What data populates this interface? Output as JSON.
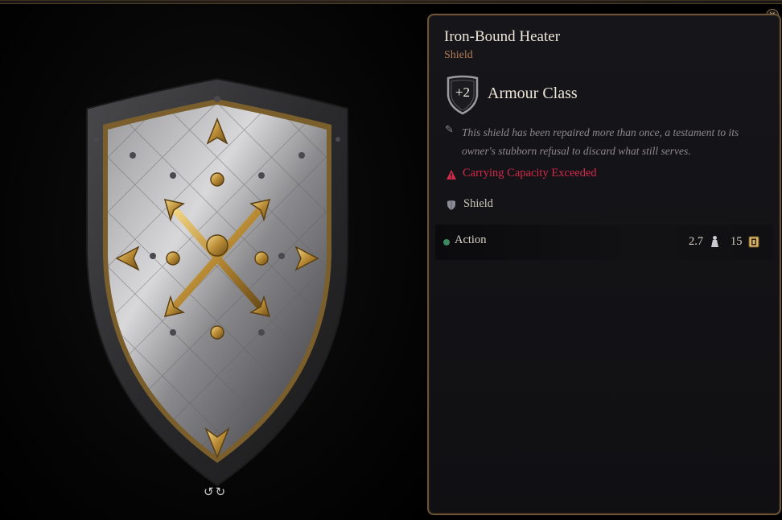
{
  "window": {
    "close_label": "×"
  },
  "preview": {
    "item_image": "heater-shield-with-gold-star-cross",
    "rotate_icon": "rotate-arrows-icon",
    "rotate_glyph": "↺↻"
  },
  "tooltip": {
    "name": "Iron-Bound Heater",
    "type": "Shield",
    "armour_class": {
      "value": "+2",
      "label": "Armour Class",
      "icon": "shield-badge-icon"
    },
    "description": "This shield has been repaired more than once, a testament to its owner's stubborn refusal to discard what still serves.",
    "description_icon": "quill-icon",
    "warning": {
      "icon": "warning-triangle-icon",
      "text": "Carrying Capacity Exceeded",
      "color": "#d1294a"
    },
    "proficiency": {
      "icon": "shield-small-icon",
      "text": "Shield"
    },
    "footer": {
      "action_label": "Action",
      "action_color": "#3d8a5e",
      "weight": "2.7",
      "weight_icon": "weight-icon",
      "price": "15",
      "price_icon": "gold-coin-icon"
    }
  },
  "colors": {
    "border": "#6b5439",
    "title": "#ece6da",
    "subtitle": "#b27a54",
    "flavor": "#8c8790"
  }
}
